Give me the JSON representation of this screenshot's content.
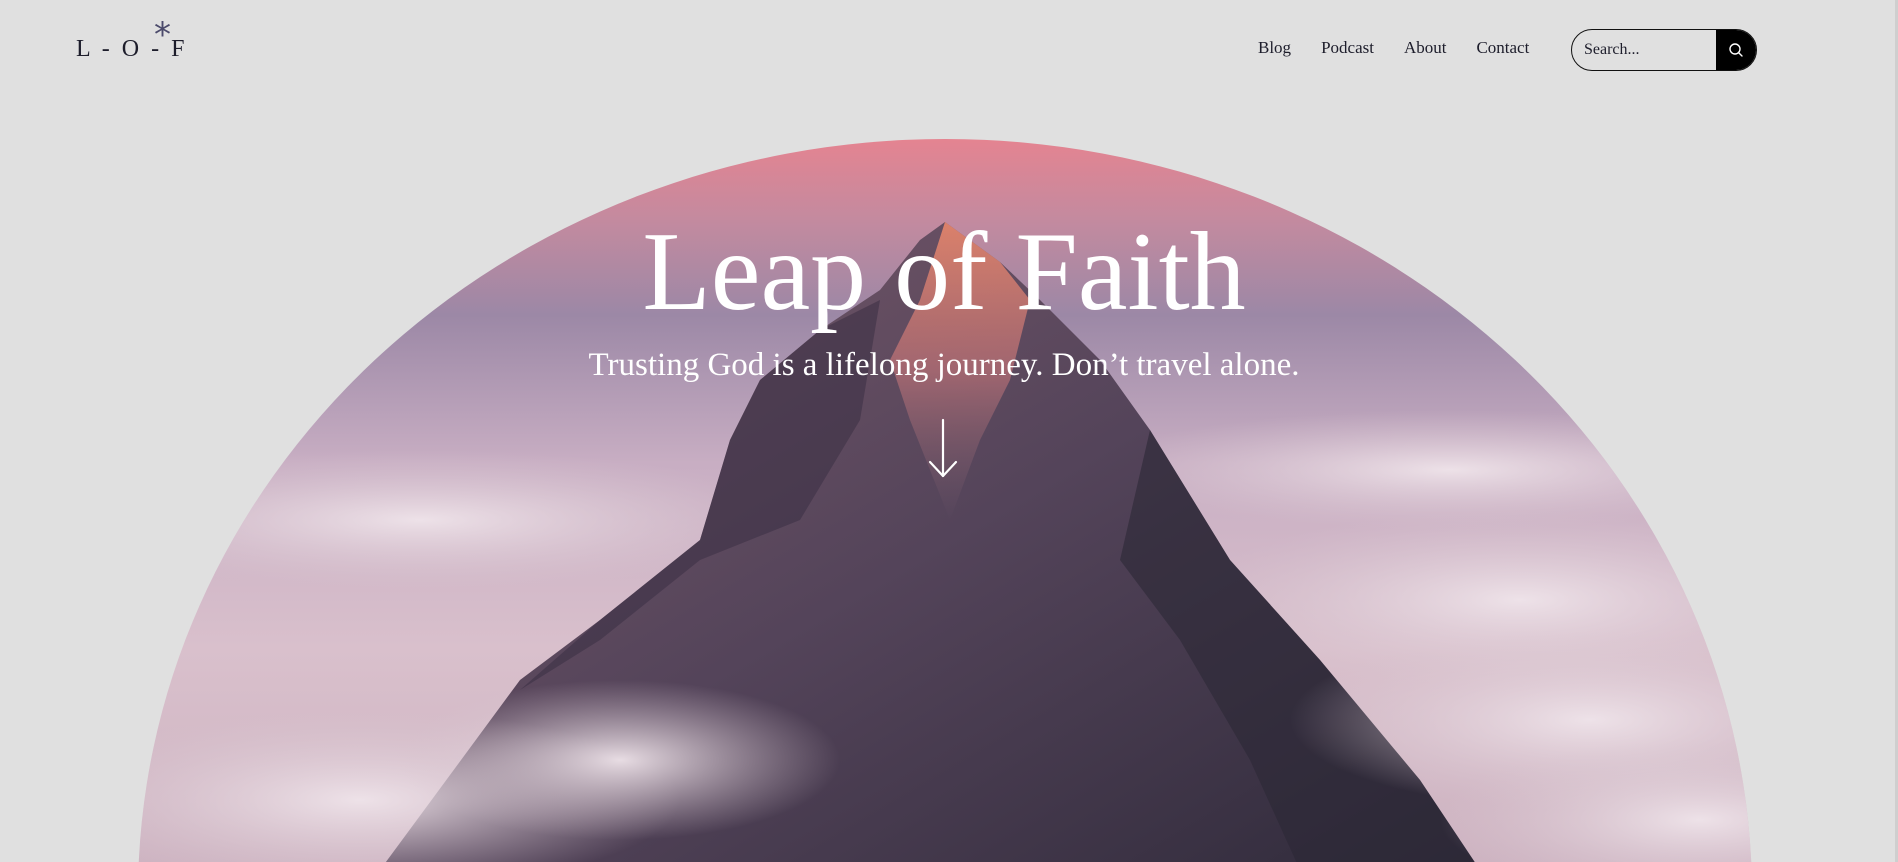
{
  "header": {
    "logo_text": "L - O - F",
    "logo_mark": "*",
    "nav": [
      "Blog",
      "Podcast",
      "About",
      "Contact"
    ],
    "search": {
      "placeholder": "Search...",
      "icon": "search-icon"
    }
  },
  "hero": {
    "title": "Leap of Faith",
    "subtitle": "Trusting God is a lifelong journey. Don’t travel alone.",
    "scroll_icon": "arrow-down-icon",
    "image": "mountain-peak-above-clouds"
  },
  "colors": {
    "background": "#e0e0e0",
    "text": "#1d1d2b",
    "accent": "#4b4a6b",
    "search_button": "#000000"
  }
}
